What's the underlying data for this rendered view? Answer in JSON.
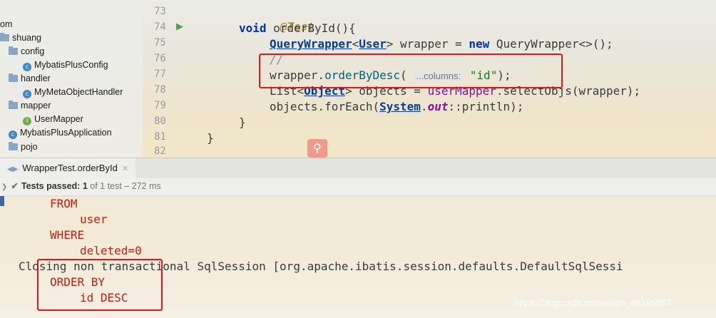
{
  "project_tree": {
    "items": [
      {
        "label": "om",
        "kind": "text"
      },
      {
        "label": "shuang",
        "kind": "folder"
      },
      {
        "label": "config",
        "kind": "folder"
      },
      {
        "label": "MybatisPlusConfig",
        "kind": "class",
        "icon": "c"
      },
      {
        "label": "handler",
        "kind": "folder"
      },
      {
        "label": "MyMetaObjectHandler",
        "kind": "class",
        "icon": "c"
      },
      {
        "label": "mapper",
        "kind": "folder"
      },
      {
        "label": "UserMapper",
        "kind": "interface",
        "icon": "I"
      },
      {
        "label": "MybatisPlusApplication",
        "kind": "class",
        "icon": "c"
      },
      {
        "label": "pojo",
        "kind": "folder"
      }
    ]
  },
  "editor": {
    "line_numbers": [
      "73",
      "74",
      "75",
      "76",
      "77",
      "78",
      "79",
      "80",
      "81",
      "82"
    ],
    "code": {
      "l73_annotation": "@Test",
      "l74_void": "void",
      "l74_rest": " orderById(){",
      "l75_type": "QueryWrapper",
      "l75_lt": "<",
      "l75_generic": "User",
      "l75_mid": "> wrapper = ",
      "l75_new": "new",
      "l75_end": " QueryWrapper<>();",
      "l76_comment": "//",
      "l77_a": "wrapper.",
      "l77_method": "orderByDesc",
      "l77_paren": "( ",
      "l77_hint": "...columns:",
      "l77_str": " \"id\"",
      "l77_end": ");",
      "l78_a": "List<",
      "l78_type": "Object",
      "l78_b": "> objects = ",
      "l78_mapper": "userMapper",
      "l78_c": ".selectObjs(wrapper);",
      "l79_a": "objects.forEach(",
      "l79_type": "System",
      "l79_dot": ".",
      "l79_field": "out",
      "l79_end": "::println);",
      "l80": "}",
      "l81": "}"
    },
    "search_icon": "search-icon"
  },
  "run_window": {
    "tab_label": "WrapperTest.orderById",
    "status_prefix": "Tests passed:",
    "status_count": "1",
    "status_suffix": "of 1 test – 272 ms"
  },
  "console": {
    "lines": [
      "FROM",
      "user",
      "WHERE",
      "deleted=0",
      "Closing non transactional SqlSession [org.apache.ibatis.session.defaults.DefaultSqlSessi",
      "ORDER BY",
      "id DESC"
    ]
  },
  "watermark": "https://blog.csdn.net/weixin_46195957"
}
